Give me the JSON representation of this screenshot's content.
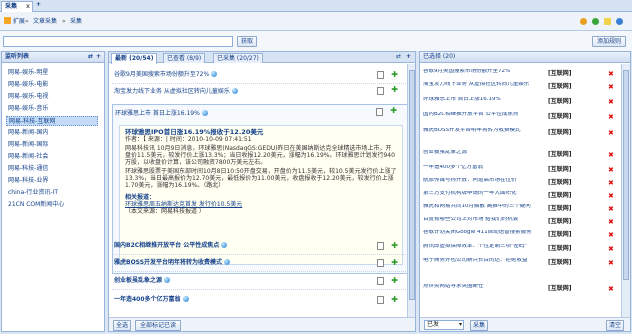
{
  "window": {
    "tab_label": "采集",
    "tab_close": "x",
    "tab_add": "+"
  },
  "toolbar": {
    "expand_label": "扩展",
    "breadcrumb": [
      "文章采集",
      "采集"
    ],
    "sep": "»"
  },
  "search": {
    "placeholder": "",
    "value": "",
    "fetch_label": "获取",
    "add_rule_label": "添加规则"
  },
  "sidebar": {
    "title": "监听列表",
    "items": [
      {
        "label": "网易-娱乐-明星"
      },
      {
        "label": "网易-娱乐-电影"
      },
      {
        "label": "网易-娱乐-电视"
      },
      {
        "label": "网易-娱乐-音乐"
      },
      {
        "label": "网易-科技-互联网"
      },
      {
        "label": "网易-新闻-国内"
      },
      {
        "label": "网易-新闻-国际"
      },
      {
        "label": "网易-新闻-社会"
      },
      {
        "label": "网易-科技-通信"
      },
      {
        "label": "网易-科技-业界"
      },
      {
        "label": "china-行业资讯-IT"
      },
      {
        "label": "21CN COM新闻中心"
      }
    ]
  },
  "main": {
    "tabs": [
      {
        "label": "最新 (20/54)"
      },
      {
        "label": "已查看 (8/9)"
      },
      {
        "label": "已采集 (20/27)"
      }
    ],
    "rows_top": [
      {
        "title": "谷歌9月美国搜索市场份额升至72%"
      },
      {
        "title": "淘宝发力线下业务 从虚拟社区转向儿童娱乐"
      }
    ],
    "expanded": {
      "title": "环球雅思上市 首日上涨16.19%",
      "headline": "环球雅思IPO首日涨16.19%报收于12.20美元",
      "meta": "作者：【 来源：| 时间：2010-10-09 07:41:51",
      "para1": "网易科技讯 10月9日消息，环球雅思(NasdaqGS:GEDU)昨日在美国纳斯达克全球精选市场上市，开盘价11.5美元，较发行价上涨13.3%；当日收报12.20美元，涨幅为16.19%。环球雅思计划发行940万股，以收盘价计算，该公司融资7800万美元左右。",
      "para2": "环球雅思股票于美国东部时间10月8日10:50开盘交易，开盘价为11.5美元，较10.5美元发行价上涨了13.3%，当日最高报价为12.70美元，最低报价为11.00美元，收盘报收于12.20美元，较发行价上涨1.70美元，涨幅为16.19%。（路北）",
      "related_title": "相关报道：",
      "related_link": "环球雅思周五纳斯达克首发 发行价10.5美元",
      "editor": "（本文来源：网易科技报道 ）"
    },
    "rows_bottom": [
      {
        "title": "国内B2C相继推开放平台 公平性成焦点"
      },
      {
        "title": "雅虎BOSS开发平台明年将转为收费模式"
      },
      {
        "title": "创业板虽乱象之源"
      },
      {
        "title": "一年造400多个亿万富翁"
      }
    ],
    "select_all_label": "全选",
    "mark_read_label": "全部标记已读"
  },
  "right": {
    "title": "已选择 (20)",
    "source_label": "[互联网]",
    "items": [
      {
        "title": "谷歌9月美国搜索市场份额升至72%"
      },
      {
        "title": "淘宝发力线下业务 从虚拟社区转向儿童娱乐"
      },
      {
        "title": "环球雅思上市 首日上涨16.19%"
      },
      {
        "title": "国内B2C相继推开放平台 公平性成焦点"
      },
      {
        "title": "雅虎BOSS开发平台明年将转为收费模式"
      },
      {
        "title": "创业板虽乱象之源"
      },
      {
        "title": "一年造400多个亿万富翁"
      },
      {
        "title": "航旅传媒号称开放：问道高市场在位价"
      },
      {
        "title": "第三方支付机构牌申请的一年大面积化"
      },
      {
        "title": "雅虎和网易共同10月解散 离推中的三个疑问"
      },
      {
        "title": "百度有哪些公司上对市场 给我们的机会"
      },
      {
        "title": "谷歌计划关闭Google 411自动语音搜索服务"
      },
      {
        "title": "腾讯即虚拟保障效率：个性定制三项\"密码\""
      },
      {
        "title": "电子商务外包公司新兴长目的达：拒绝收益"
      },
      {
        "title": "点评类网站寻求突围新任"
      }
    ],
    "status_select": "已发",
    "collect_label": "采集",
    "clear_label": "清空"
  },
  "colors": {
    "accent": "#15428b",
    "border": "#99b4d9",
    "delete": "#dd1111",
    "add": "#2a9d2a"
  }
}
